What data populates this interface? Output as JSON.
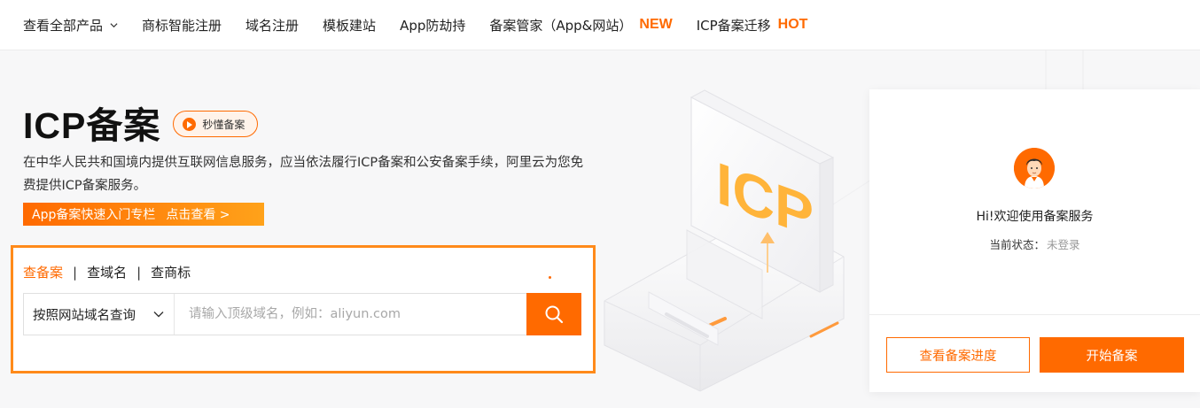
{
  "nav": {
    "items": [
      {
        "label": "查看全部产品",
        "has_chevron": true
      },
      {
        "label": "商标智能注册"
      },
      {
        "label": "域名注册"
      },
      {
        "label": "模板建站"
      },
      {
        "label": "App防劫持"
      },
      {
        "label": "备案管家（App&网站）",
        "badge": "NEW"
      },
      {
        "label": "ICP备案迁移",
        "badge": "HOT"
      }
    ]
  },
  "hero": {
    "title": "ICP备案",
    "video_button": "秒懂备案",
    "description": "在中华人民共和国境内提供互联网信息服务，应当依法履行ICP备案和公安备案手续，阿里云为您免费提供ICP备案服务。",
    "promo_text": "App备案快速入门专栏",
    "promo_link": "点击查看 >"
  },
  "search": {
    "tabs": [
      {
        "label": "查备案",
        "active": true
      },
      {
        "label": "查域名",
        "active": false
      },
      {
        "label": "查商标",
        "active": false
      }
    ],
    "select_value": "按照网站域名查询",
    "placeholder": "请输入顶级域名，例如：aliyun.com",
    "icon": "search-icon"
  },
  "illustration": {
    "text": "ICP"
  },
  "card": {
    "greeting": "Hi!欢迎使用备案服务",
    "status_label": "当前状态：",
    "status_value": "未登录",
    "progress_button": "查看备案进度",
    "start_button": "开始备案"
  },
  "colors": {
    "accent": "#ff6a00",
    "frame": "#ff8a1a",
    "background": "#f7f7f8"
  }
}
